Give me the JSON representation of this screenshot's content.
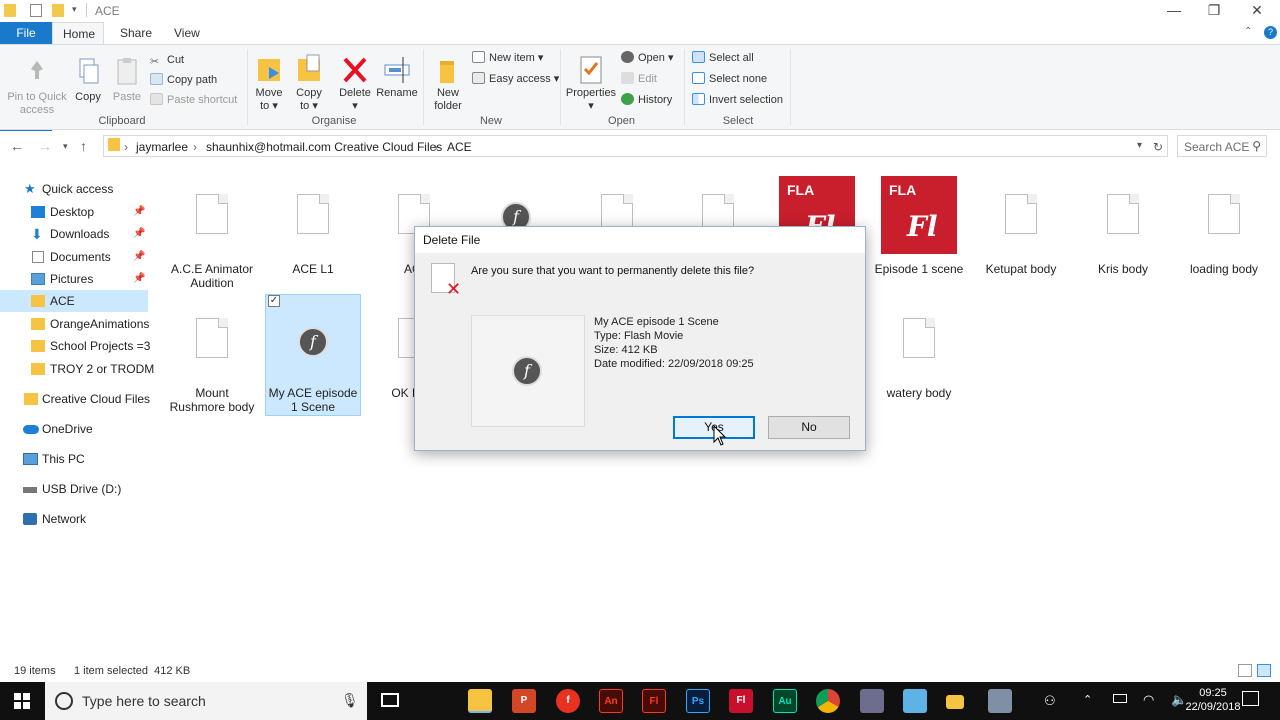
{
  "window": {
    "title": "ACE",
    "minimize_glyph": "—",
    "restore_glyph": "❐",
    "close_glyph": "✕"
  },
  "tabs": [
    {
      "label": "File"
    },
    {
      "label": "Home"
    },
    {
      "label": "Share"
    },
    {
      "label": "View"
    }
  ],
  "ribbon": {
    "clipboard": {
      "pin": "Pin to Quick access",
      "copy": "Copy",
      "paste": "Paste",
      "cut": "Cut",
      "copy_path": "Copy path",
      "paste_shortcut": "Paste shortcut",
      "group": "Clipboard"
    },
    "organise": {
      "move_to": "Move to",
      "copy_to": "Copy to",
      "delete": "Delete",
      "rename": "Rename",
      "group": "Organise"
    },
    "new": {
      "new_folder": "New folder",
      "new_item": "New item",
      "easy_access": "Easy access",
      "group": "New"
    },
    "open": {
      "properties": "Properties",
      "open": "Open",
      "edit": "Edit",
      "history": "History",
      "group": "Open"
    },
    "select": {
      "select_all": "Select all",
      "select_none": "Select none",
      "invert": "Invert selection",
      "group": "Select"
    }
  },
  "address": {
    "crumbs": [
      "jaymarlee",
      "shaunhix@hotmail.com Creative Cloud Files",
      "ACE"
    ],
    "search_placeholder": "Search ACE"
  },
  "nav": {
    "items": [
      {
        "label": "Quick access"
      },
      {
        "label": "Desktop"
      },
      {
        "label": "Downloads"
      },
      {
        "label": "Documents"
      },
      {
        "label": "Pictures"
      },
      {
        "label": "ACE"
      },
      {
        "label": "OrangeAnimations"
      },
      {
        "label": "School Projects =3"
      },
      {
        "label": "TROY 2 or TRODM"
      },
      {
        "label": "Creative Cloud Files"
      },
      {
        "label": "OneDrive"
      },
      {
        "label": "This PC"
      },
      {
        "label": "USB Drive (D:)"
      },
      {
        "label": "Network"
      }
    ]
  },
  "files": {
    "row1": [
      {
        "name": "A.C.E Animator Audition"
      },
      {
        "name": "ACE L1"
      },
      {
        "name": "ACI"
      },
      {
        "name": ""
      },
      {
        "name": ""
      },
      {
        "name": ""
      },
      {
        "name": ""
      },
      {
        "name": "Episode 1 scene"
      },
      {
        "name": "Ketupat body"
      },
      {
        "name": "Kris body"
      },
      {
        "name": "loading body"
      }
    ],
    "row2": [
      {
        "name": "Mount Rushmore body"
      },
      {
        "name": "My ACE episode 1 Scene"
      },
      {
        "name": "OK Emo"
      },
      {
        "name": "watery body"
      }
    ],
    "fla_badge": "FLA",
    "fl_mark": "Fl",
    "flash_mark": "f"
  },
  "status": {
    "count": "19 items",
    "selection": "1 item selected  412 KB"
  },
  "dialog": {
    "title": "Delete File",
    "question": "Are you sure that you want to permanently delete this file?",
    "file_name": "My ACE episode 1 Scene",
    "file_type": "Type: Flash Movie",
    "file_size": "Size: 412 KB",
    "file_modified": "Date modified: 22/09/2018 09:25",
    "yes": "Yes",
    "no": "No"
  },
  "taskbar": {
    "search_placeholder": "Type here to search",
    "apps": [
      "Explorer",
      "PowerPoint",
      "Flash",
      "Animate",
      "Flash Pro",
      "Photoshop",
      "Flash",
      "Audition",
      "Chrome",
      "Capture",
      "Notes",
      "Folder",
      "Camera"
    ],
    "app_labels": {
      "powerpoint": "P",
      "flash": "f",
      "animate": "An",
      "flash_pro": "Fl",
      "photoshop": "Ps",
      "flash_b": "Fl",
      "audition": "Au"
    },
    "time": "09:25",
    "date": "22/09/2018"
  },
  "colors": {
    "accent": "#1979ca",
    "delete_red": "#e81123",
    "fla_red": "#c91f2c",
    "selection": "#cce8ff"
  }
}
